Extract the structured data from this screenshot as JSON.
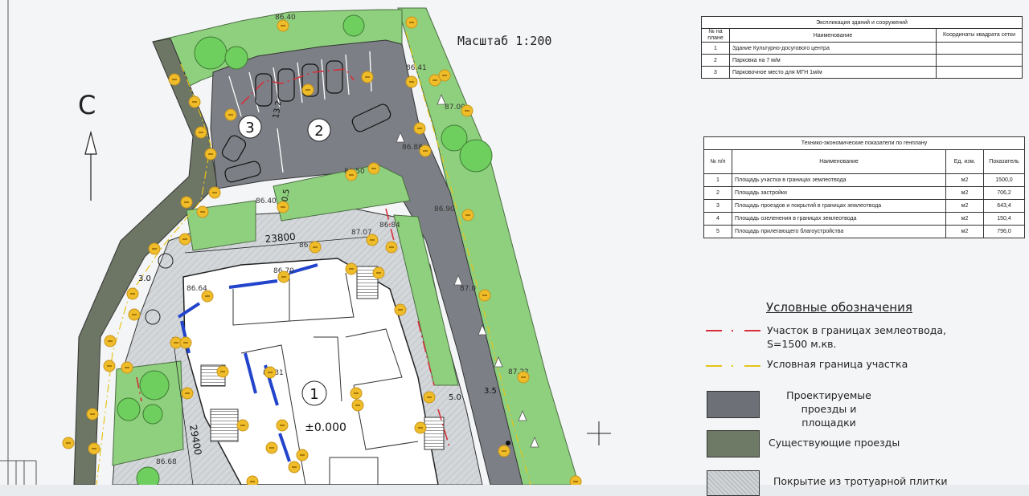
{
  "sheet": {
    "scale_label": "Масштаб 1:200",
    "north_letter": "С"
  },
  "plan": {
    "building_number": "1",
    "parking_number": "2",
    "mgn_number": "3",
    "zero_level": "±0.000",
    "dimensions": {
      "width": "23800",
      "length": "29400",
      "d1": "10.5",
      "d2": "13.2",
      "d3": "5.0",
      "d4": "3.5",
      "d5": "3.0"
    },
    "elevations": [
      "86.40",
      "86.41",
      "87.00",
      "86.88",
      "86.50",
      "86.40",
      "86.90",
      "86.64",
      "86.70",
      "86.61",
      "87.07",
      "86.84",
      "87.0",
      "87.22",
      "86.68",
      "87.31"
    ]
  },
  "explication": {
    "title": "Экспликация зданий и сооружений",
    "headers": [
      "№ на плане",
      "Наименование",
      "Координаты квадрата сетки"
    ],
    "rows": [
      [
        "1",
        "Здание Культурно-досугового центра",
        ""
      ],
      [
        "2",
        "Парковка на 7 м/м",
        ""
      ],
      [
        "3",
        "Парковочное место для МГН 1м/м",
        ""
      ]
    ]
  },
  "indicators": {
    "title": "Технико-экономические показатели по генплану",
    "headers": [
      "№ п/п",
      "Наименование",
      "Ед. изм.",
      "Показатель"
    ],
    "rows": [
      [
        "1",
        "Площадь участка в границах землеотвода",
        "м2",
        "1500,0"
      ],
      [
        "2",
        "Площадь застройки",
        "м2",
        "706,2"
      ],
      [
        "3",
        "Площадь проездов и покрытий в границах землеотвода",
        "м2",
        "643,4"
      ],
      [
        "4",
        "Площадь озеленения в границах землеотвода",
        "м2",
        "150,4"
      ],
      [
        "5",
        "Площадь прилегающего благоустройства",
        "м2",
        "796,0"
      ]
    ]
  },
  "legend": {
    "title": "Условные обозначения",
    "items": [
      {
        "text": "Участок в границах землеотвода, S=1500 м.кв.",
        "line1": "Участок в границах землеотвода,",
        "line2": "S=1500 м.кв.",
        "color": "#d6303a"
      },
      {
        "text": "Условная граница участка",
        "color": "#e6c419"
      },
      {
        "text": "Проектируемые проезды и площадки",
        "line1": "Проектируемые проезды и",
        "line2": "площадки",
        "color": "#6e7078"
      },
      {
        "text": "Существующие проезды",
        "color": "#6f7a66"
      },
      {
        "text": "Покрытие из тротуарной плитки",
        "color": "#cfd3d6"
      }
    ]
  },
  "colors": {
    "green": "#8fd07e",
    "asphalt": "#7c7f85",
    "existing_road": "#6d7564",
    "paving": "#d3d7da",
    "red_boundary": "#d6303a",
    "marker": "#efbd2a",
    "blue_wall": "#2244cc"
  }
}
